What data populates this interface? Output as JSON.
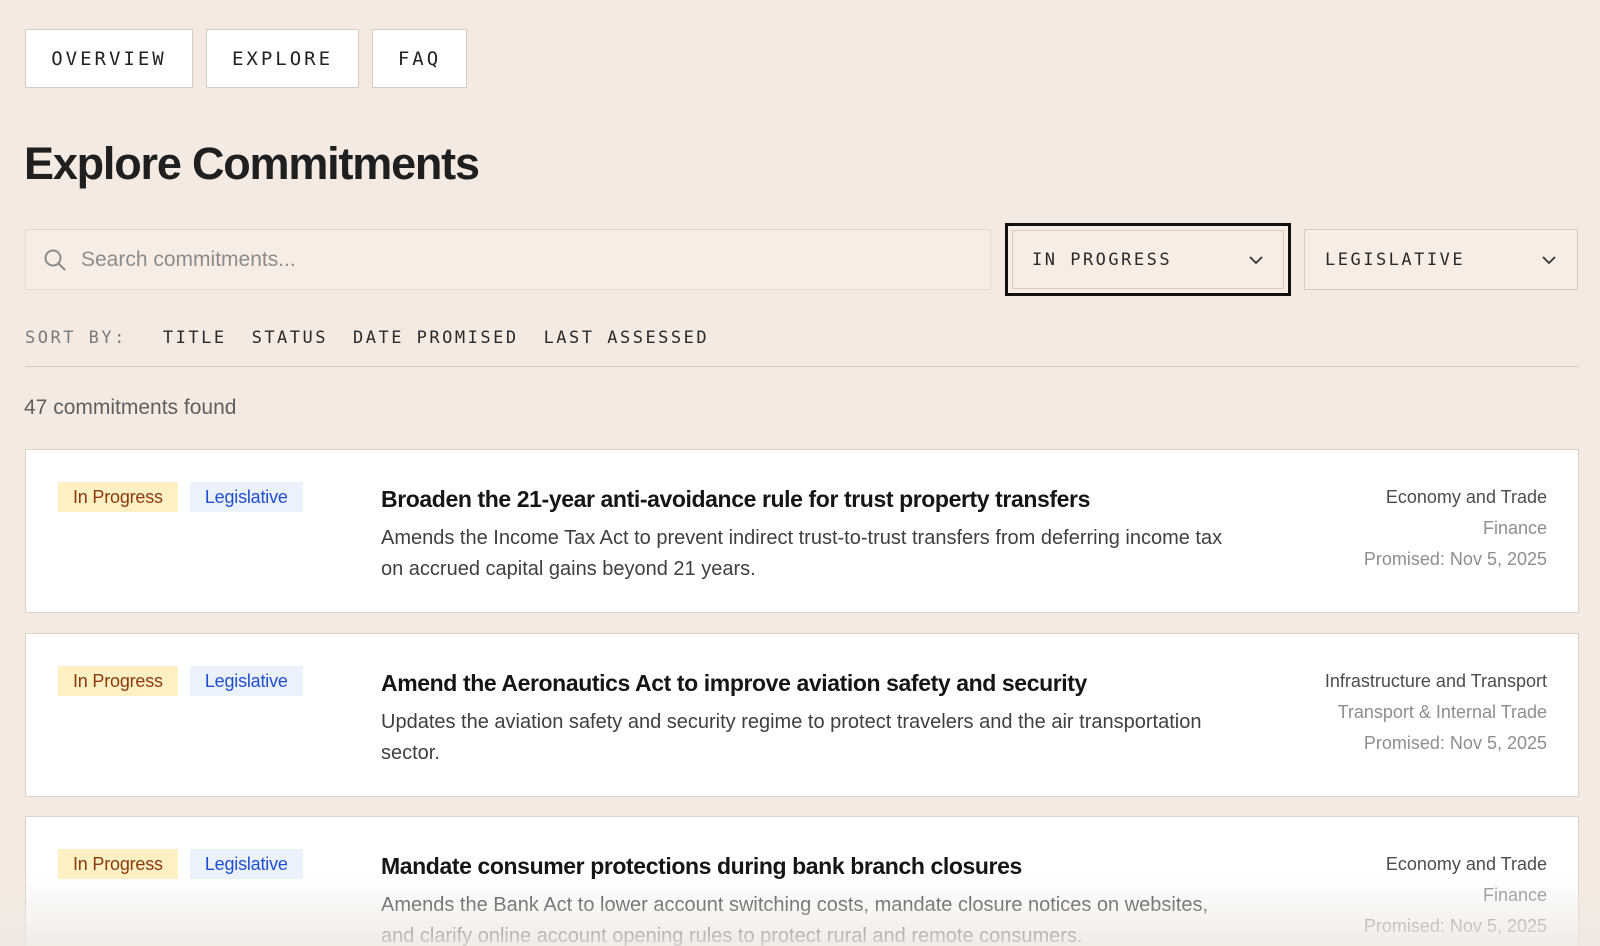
{
  "nav": [
    {
      "label": "OVERVIEW"
    },
    {
      "label": "EXPLORE"
    },
    {
      "label": "FAQ"
    }
  ],
  "page_title": "Explore Commitments",
  "search": {
    "placeholder": "Search commitments...",
    "value": ""
  },
  "filters": {
    "status": {
      "selected": "IN PROGRESS"
    },
    "category": {
      "selected": "LEGISLATIVE"
    }
  },
  "sort": {
    "label": "SORT BY:",
    "options": [
      "TITLE",
      "STATUS",
      "DATE PROMISED",
      "LAST ASSESSED"
    ]
  },
  "results_count": "47 commitments found",
  "commitments": [
    {
      "status": "In Progress",
      "type": "Legislative",
      "title": "Broaden the 21-year anti-avoidance rule for trust property transfers",
      "description": "Amends the Income Tax Act to prevent indirect trust-to-trust transfers from deferring income tax on accrued capital gains beyond 21 years.",
      "area": "Economy and Trade",
      "department": "Finance",
      "promised": "Promised: Nov 5, 2025"
    },
    {
      "status": "In Progress",
      "type": "Legislative",
      "title": "Amend the Aeronautics Act to improve aviation safety and security",
      "description": "Updates the aviation safety and security regime to protect travelers and the air transportation sector.",
      "area": "Infrastructure and Transport",
      "department": "Transport & Internal Trade",
      "promised": "Promised: Nov 5, 2025"
    },
    {
      "status": "In Progress",
      "type": "Legislative",
      "title": "Mandate consumer protections during bank branch closures",
      "description": "Amends the Bank Act to lower account switching costs, mandate closure notices on websites, and clarify online account opening rules to protect rural and remote consumers.",
      "area": "Economy and Trade",
      "department": "Finance",
      "promised": "Promised: Nov 5, 2025"
    }
  ],
  "colors": {
    "background": "#f5eae1",
    "status_badge_bg": "#fdf1c4",
    "status_badge_text": "#8a3a10",
    "type_badge_bg": "#ecf2fb",
    "type_badge_text": "#1f4fd1"
  },
  "icons": {
    "search": "search-icon",
    "dropdown": "chevron-down-icon"
  }
}
